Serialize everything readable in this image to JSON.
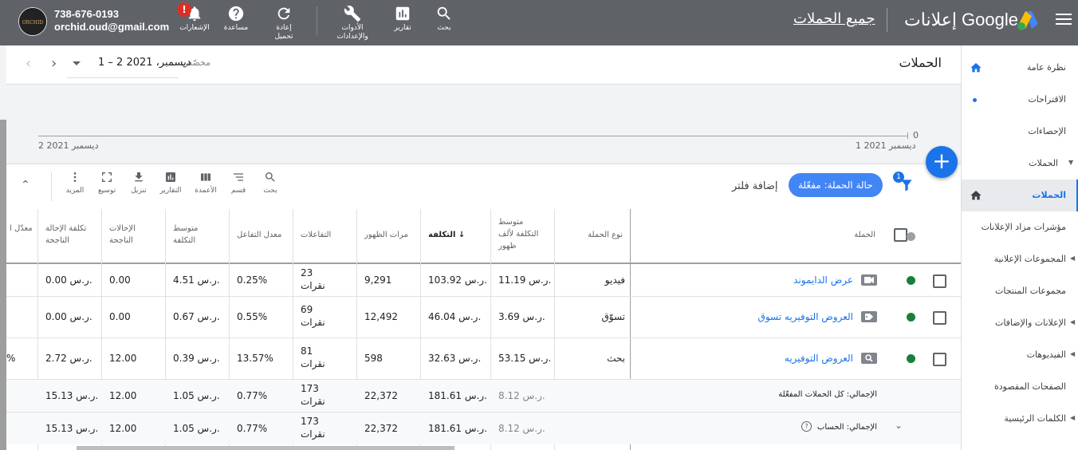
{
  "topbar": {
    "account_phone": "738-676-0193",
    "account_email": "orchid.oud@gmail.com",
    "notifications_label": "الإشعارات",
    "notifications_badge": "!",
    "help_label": "مساعدة",
    "refresh_label": "إعادة تحميل",
    "tools_label_1": "الأدوات",
    "tools_label_2": "والإعدادات",
    "reports_label": "تقارير",
    "search_label": "بحث",
    "brand": "إعلانات Google",
    "all_campaigns": "جميع الحملات"
  },
  "sidebar": {
    "items": [
      {
        "label": "نظرة عامة",
        "icon": "home-icon"
      },
      {
        "label": "الاقتراحات"
      },
      {
        "label": "الإحصاءات"
      },
      {
        "label": "الحملات"
      },
      {
        "label": "الحملات",
        "icon": "home-icon",
        "active": true
      },
      {
        "label": "مؤشرات مزاد الإعلانات"
      },
      {
        "label": "المجموعات الإعلانية"
      },
      {
        "label": "مجموعات المنتجات"
      },
      {
        "label": "الإعلانات والإضافات"
      },
      {
        "label": "الفيديوهات"
      },
      {
        "label": "الصفحات المقصودة"
      },
      {
        "label": "الكلمات الرئيسية"
      }
    ]
  },
  "header": {
    "title": "الحملات",
    "date_mode": "مخصّص",
    "date_range": "1 – 2 ديسمبر، 2021"
  },
  "chart": {
    "y_zero": "0",
    "x_start": "1 ديسمبر 2021",
    "x_end": "2 ديسمبر 2021"
  },
  "toolbar": {
    "filter_count": "1",
    "status_chip": "حالة الحملة: مفعّلة",
    "add_filter": "إضافة فلتر",
    "search": "بحث",
    "segment": "قسم",
    "columns": "الأعمدة",
    "reports": "التقارير",
    "download": "تنزيل",
    "expand": "توسيع",
    "more": "المزيد"
  },
  "table": {
    "headers": {
      "campaign": "الحملة",
      "type": "نوع الحملة",
      "avg_cpm": "متوسط التكلفة لألف ظهور",
      "cost": "التكلفة",
      "impressions": "مرات الظهور",
      "interactions": "التفاعلات",
      "interaction_rate": "معدل التفاعل",
      "avg_cost": "متوسط التكلفة",
      "conversions": "الإحالات الناجحة",
      "cost_per_conv": "تكلفة الإحالة الناجحة",
      "conv_rate": "معدّل ا"
    },
    "rows": [
      {
        "name": "عرض الدايموند",
        "type": "فيديو",
        "avg_cpm": "11.19 ر.س.",
        "cost": "103.92 ر.س.",
        "impressions": "9,291",
        "interactions": "23",
        "interactions_unit": "نقرات",
        "interaction_rate": "0.25%",
        "avg_cost": "4.51 ر.س.",
        "conversions": "0.00",
        "cost_per_conv": "0.00 ر.س.",
        "conv_rate": ""
      },
      {
        "name": "العروض التوفيريه تسوق",
        "type": "تسوّق",
        "avg_cpm": "3.69 ر.س.",
        "cost": "46.04 ر.س.",
        "impressions": "12,492",
        "interactions": "69",
        "interactions_unit": "نقرات",
        "interaction_rate": "0.55%",
        "avg_cost": "0.67 ر.س.",
        "conversions": "0.00",
        "cost_per_conv": "0.00 ر.س.",
        "conv_rate": ""
      },
      {
        "name": "العروض التوفيريه",
        "type": "بحث",
        "avg_cpm": "53.15 ر.س.",
        "cost": "32.63 ر.س.",
        "impressions": "598",
        "interactions": "81",
        "interactions_unit": "نقرات",
        "interaction_rate": "13.57%",
        "avg_cost": "0.39 ر.س.",
        "conversions": "12.00",
        "cost_per_conv": "2.72 ر.س.",
        "conv_rate": "%"
      }
    ],
    "totals": [
      {
        "label": "الإجمالي: كل الحملات المفعّلة",
        "avg_cpm": "8.12 ر.س.",
        "cost": "181.61 ر.س.",
        "impressions": "22,372",
        "interactions": "173",
        "interactions_unit": "نقرات",
        "interaction_rate": "0.77%",
        "avg_cost": "1.05 ر.س.",
        "conversions": "12.00",
        "cost_per_conv": "15.13 ر.س."
      },
      {
        "label": "الإجمالي: الحساب",
        "avg_cpm": "8.12 ر.س.",
        "cost": "181.61 ر.س.",
        "impressions": "22,372",
        "interactions": "173",
        "interactions_unit": "نقرات",
        "interaction_rate": "0.77%",
        "avg_cost": "1.05 ر.س.",
        "conversions": "12.00",
        "cost_per_conv": "15.13 ر.س."
      }
    ]
  }
}
